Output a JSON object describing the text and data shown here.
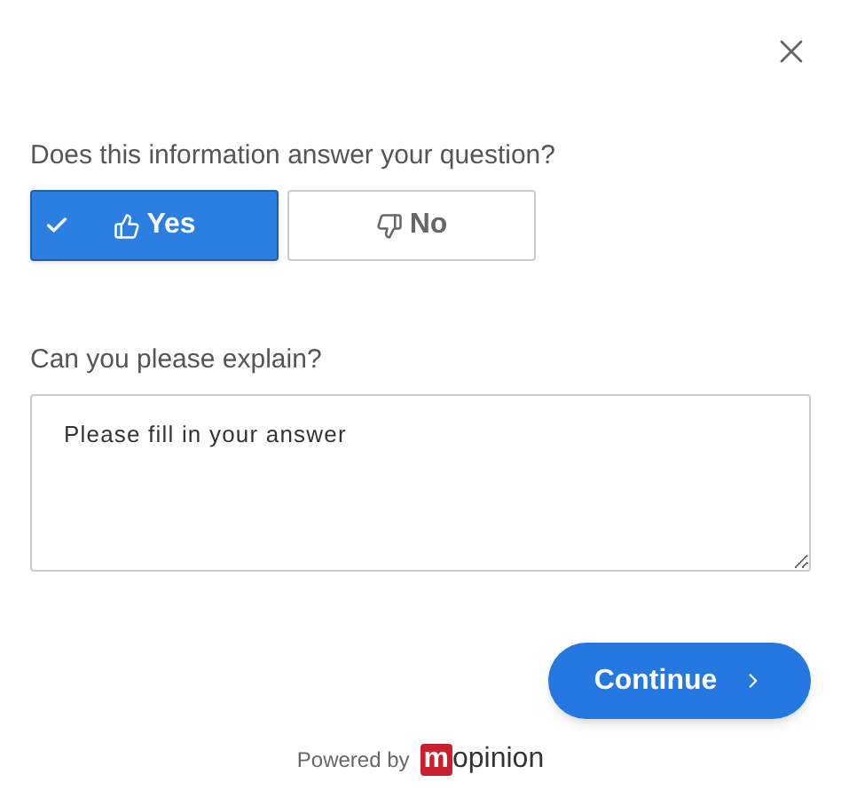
{
  "question": "Does this information answer your question?",
  "options": [
    {
      "label": "Yes",
      "kind": "up",
      "selected": true
    },
    {
      "label": "No",
      "kind": "down",
      "selected": false
    }
  ],
  "explain": {
    "label": "Can you please explain?",
    "placeholder": "Please fill in your answer"
  },
  "continue": "Continue",
  "footer": {
    "powered": "Powered by",
    "logo_mark": "m",
    "logo_rest": "opinion"
  }
}
